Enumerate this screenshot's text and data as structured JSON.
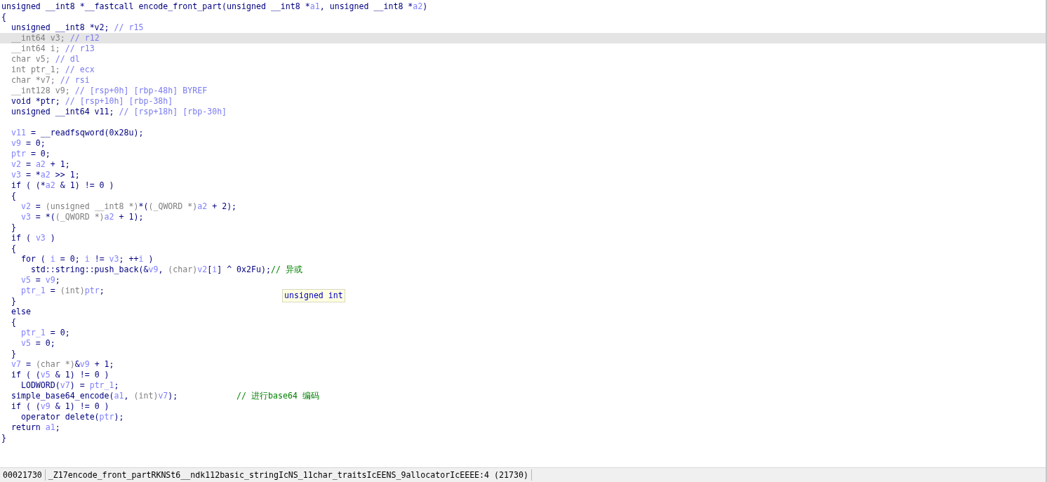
{
  "code_lines": [
    {
      "selected": false,
      "tokens": [
        {
          "kind": "n",
          "text": "unsigned __int8 *__fastcall encode_front_part(unsigned __int8 *"
        },
        {
          "kind": "v",
          "text": "a1"
        },
        {
          "kind": "n",
          "text": ", unsigned __int8 *"
        },
        {
          "kind": "v",
          "text": "a2"
        },
        {
          "kind": "n",
          "text": ")"
        }
      ]
    },
    {
      "selected": false,
      "tokens": [
        {
          "kind": "n",
          "text": "{"
        }
      ]
    },
    {
      "selected": false,
      "tokens": [
        {
          "kind": "n",
          "text": "  unsigned __int8 *v2; "
        },
        {
          "kind": "c",
          "text": "// r15"
        }
      ]
    },
    {
      "selected": true,
      "tokens": [
        {
          "kind": "g",
          "text": "  __int64 v3; "
        },
        {
          "kind": "c",
          "text": "// r12"
        }
      ]
    },
    {
      "selected": false,
      "tokens": [
        {
          "kind": "g",
          "text": "  __int64 i; "
        },
        {
          "kind": "c",
          "text": "// r13"
        }
      ]
    },
    {
      "selected": false,
      "tokens": [
        {
          "kind": "g",
          "text": "  char v5; "
        },
        {
          "kind": "c",
          "text": "// dl"
        }
      ]
    },
    {
      "selected": false,
      "tokens": [
        {
          "kind": "g",
          "text": "  int ptr_1; "
        },
        {
          "kind": "c",
          "text": "// ecx"
        }
      ]
    },
    {
      "selected": false,
      "tokens": [
        {
          "kind": "g",
          "text": "  char *v7; "
        },
        {
          "kind": "c",
          "text": "// rsi"
        }
      ]
    },
    {
      "selected": false,
      "tokens": [
        {
          "kind": "g",
          "text": "  __int128 v9; "
        },
        {
          "kind": "c",
          "text": "// [rsp+0h] [rbp-48h] BYREF"
        }
      ]
    },
    {
      "selected": false,
      "tokens": [
        {
          "kind": "n",
          "text": "  void *ptr; "
        },
        {
          "kind": "c",
          "text": "// [rsp+10h] [rbp-38h]"
        }
      ]
    },
    {
      "selected": false,
      "tokens": [
        {
          "kind": "n",
          "text": "  unsigned __int64 v11; "
        },
        {
          "kind": "c",
          "text": "// [rsp+18h] [rbp-30h]"
        }
      ]
    },
    {
      "selected": false
    },
    {
      "selected": false,
      "tokens": [
        {
          "kind": "v",
          "text": "  v11"
        },
        {
          "kind": "n",
          "text": " = __readfsqword(0x28u);"
        }
      ]
    },
    {
      "selected": false,
      "tokens": [
        {
          "kind": "v",
          "text": "  v9"
        },
        {
          "kind": "n",
          "text": " = 0;"
        }
      ]
    },
    {
      "selected": false,
      "tokens": [
        {
          "kind": "v",
          "text": "  ptr"
        },
        {
          "kind": "n",
          "text": " = 0;"
        }
      ]
    },
    {
      "selected": false,
      "tokens": [
        {
          "kind": "v",
          "text": "  v2"
        },
        {
          "kind": "n",
          "text": " = "
        },
        {
          "kind": "v",
          "text": "a2"
        },
        {
          "kind": "n",
          "text": " + 1;"
        }
      ]
    },
    {
      "selected": false,
      "tokens": [
        {
          "kind": "v",
          "text": "  v3"
        },
        {
          "kind": "n",
          "text": " = *"
        },
        {
          "kind": "v",
          "text": "a2"
        },
        {
          "kind": "n",
          "text": " >> 1;"
        }
      ]
    },
    {
      "selected": false,
      "tokens": [
        {
          "kind": "n",
          "text": "  if ( (*"
        },
        {
          "kind": "v",
          "text": "a2"
        },
        {
          "kind": "n",
          "text": " & 1) != 0 )"
        }
      ]
    },
    {
      "selected": false,
      "tokens": [
        {
          "kind": "n",
          "text": "  {"
        }
      ]
    },
    {
      "selected": false,
      "tokens": [
        {
          "kind": "v",
          "text": "    v2"
        },
        {
          "kind": "n",
          "text": " = "
        },
        {
          "kind": "g",
          "text": "(unsigned __int8 *)"
        },
        {
          "kind": "n",
          "text": "*("
        },
        {
          "kind": "g",
          "text": "(_QWORD *)"
        },
        {
          "kind": "v",
          "text": "a2"
        },
        {
          "kind": "n",
          "text": " + 2);"
        }
      ]
    },
    {
      "selected": false,
      "tokens": [
        {
          "kind": "v",
          "text": "    v3"
        },
        {
          "kind": "n",
          "text": " = *("
        },
        {
          "kind": "g",
          "text": "(_QWORD *)"
        },
        {
          "kind": "v",
          "text": "a2"
        },
        {
          "kind": "n",
          "text": " + 1);"
        }
      ]
    },
    {
      "selected": false,
      "tokens": [
        {
          "kind": "n",
          "text": "  }"
        }
      ]
    },
    {
      "selected": false,
      "tokens": [
        {
          "kind": "n",
          "text": "  if ( "
        },
        {
          "kind": "v",
          "text": "v3"
        },
        {
          "kind": "n",
          "text": " )"
        }
      ]
    },
    {
      "selected": false,
      "tokens": [
        {
          "kind": "n",
          "text": "  {"
        }
      ]
    },
    {
      "selected": false,
      "tokens": [
        {
          "kind": "n",
          "text": "    for ( "
        },
        {
          "kind": "v",
          "text": "i"
        },
        {
          "kind": "n",
          "text": " = 0; "
        },
        {
          "kind": "v",
          "text": "i"
        },
        {
          "kind": "n",
          "text": " != "
        },
        {
          "kind": "v",
          "text": "v3"
        },
        {
          "kind": "n",
          "text": "; ++"
        },
        {
          "kind": "v",
          "text": "i"
        },
        {
          "kind": "n",
          "text": " )"
        }
      ]
    },
    {
      "selected": false,
      "tokens": [
        {
          "kind": "n",
          "text": "      std::string::push_back(&"
        },
        {
          "kind": "v",
          "text": "v9"
        },
        {
          "kind": "n",
          "text": ", "
        },
        {
          "kind": "g",
          "text": "(char)"
        },
        {
          "kind": "v",
          "text": "v2"
        },
        {
          "kind": "n",
          "text": "["
        },
        {
          "kind": "v",
          "text": "i"
        },
        {
          "kind": "n",
          "text": "] ^ 0x2Fu);"
        },
        {
          "kind": "z",
          "text": "// 异或"
        }
      ]
    },
    {
      "selected": false,
      "tokens": [
        {
          "kind": "v",
          "text": "    v5"
        },
        {
          "kind": "n",
          "text": " = "
        },
        {
          "kind": "v",
          "text": "v9"
        },
        {
          "kind": "n",
          "text": ";"
        }
      ]
    },
    {
      "selected": false,
      "tokens": [
        {
          "kind": "v",
          "text": "    ptr_1"
        },
        {
          "kind": "n",
          "text": " = "
        },
        {
          "kind": "g",
          "text": "(int)"
        },
        {
          "kind": "v",
          "text": "ptr"
        },
        {
          "kind": "n",
          "text": ";"
        }
      ]
    },
    {
      "selected": false,
      "tokens": [
        {
          "kind": "n",
          "text": "  }"
        }
      ]
    },
    {
      "selected": false,
      "tokens": [
        {
          "kind": "n",
          "text": "  else"
        }
      ]
    },
    {
      "selected": false,
      "tokens": [
        {
          "kind": "n",
          "text": "  {"
        }
      ]
    },
    {
      "selected": false,
      "tokens": [
        {
          "kind": "v",
          "text": "    ptr_1"
        },
        {
          "kind": "n",
          "text": " = 0;"
        }
      ]
    },
    {
      "selected": false,
      "tokens": [
        {
          "kind": "v",
          "text": "    v5"
        },
        {
          "kind": "n",
          "text": " = 0;"
        }
      ]
    },
    {
      "selected": false,
      "tokens": [
        {
          "kind": "n",
          "text": "  }"
        }
      ]
    },
    {
      "selected": false,
      "tokens": [
        {
          "kind": "v",
          "text": "  v7"
        },
        {
          "kind": "n",
          "text": " = "
        },
        {
          "kind": "g",
          "text": "(char *)"
        },
        {
          "kind": "n",
          "text": "&"
        },
        {
          "kind": "v",
          "text": "v9"
        },
        {
          "kind": "n",
          "text": " + 1;"
        }
      ]
    },
    {
      "selected": false,
      "tokens": [
        {
          "kind": "n",
          "text": "  if ( ("
        },
        {
          "kind": "v",
          "text": "v5"
        },
        {
          "kind": "n",
          "text": " & 1) != 0 )"
        }
      ]
    },
    {
      "selected": false,
      "tokens": [
        {
          "kind": "n",
          "text": "    LODWORD("
        },
        {
          "kind": "v",
          "text": "v7"
        },
        {
          "kind": "n",
          "text": ") = "
        },
        {
          "kind": "v",
          "text": "ptr_1"
        },
        {
          "kind": "n",
          "text": ";"
        }
      ]
    },
    {
      "selected": false,
      "tokens": [
        {
          "kind": "n",
          "text": "  simple_base64_encode("
        },
        {
          "kind": "v",
          "text": "a1"
        },
        {
          "kind": "n",
          "text": ", "
        },
        {
          "kind": "g",
          "text": "(int)"
        },
        {
          "kind": "v",
          "text": "v7"
        },
        {
          "kind": "n",
          "text": ");            "
        },
        {
          "kind": "z",
          "text": "// 进行base64 编码"
        }
      ]
    },
    {
      "selected": false,
      "tokens": [
        {
          "kind": "n",
          "text": "  if ( ("
        },
        {
          "kind": "v",
          "text": "v9"
        },
        {
          "kind": "n",
          "text": " & 1) != 0 )"
        }
      ]
    },
    {
      "selected": false,
      "tokens": [
        {
          "kind": "n",
          "text": "    operator delete("
        },
        {
          "kind": "v",
          "text": "ptr"
        },
        {
          "kind": "n",
          "text": ");"
        }
      ]
    },
    {
      "selected": false,
      "tokens": [
        {
          "kind": "n",
          "text": "  return "
        },
        {
          "kind": "v",
          "text": "a1"
        },
        {
          "kind": "n",
          "text": ";"
        }
      ]
    },
    {
      "selected": false,
      "tokens": [
        {
          "kind": "n",
          "text": "}"
        }
      ]
    }
  ],
  "tooltip": {
    "text": "unsigned int"
  },
  "status_bar": {
    "address": "00021730",
    "location": "_Z17encode_front_partRKNSt6__ndk112basic_stringIcNS_11char_traitsIcEENS_9allocatorIcEEEE:4 (21730)"
  }
}
